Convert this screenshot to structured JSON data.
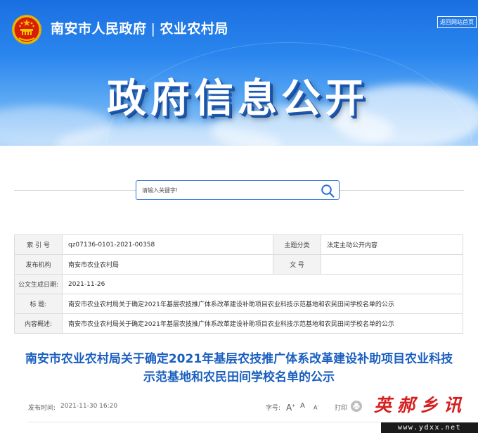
{
  "header": {
    "site_name_part1": "南安市人民政府",
    "separator": "|",
    "site_name_part2": "农业农村局",
    "home_link": "返回网站首页",
    "banner_title": "政府信息公开"
  },
  "search": {
    "placeholder": "请输入关键字!"
  },
  "meta": {
    "index_label": "索 引 号",
    "index_value": "qz07136-0101-2021-00358",
    "category_label": "主题分类",
    "category_value": "法定主动公开内容",
    "publisher_label": "发布机构",
    "publisher_value": "南安市农业农村局",
    "doc_no_label": "文 号",
    "doc_no_value": "",
    "date_label": "公文生成日期:",
    "date_value": "2021-11-26",
    "title_label": "标 题:",
    "title_value": "南安市农业农村局关于确定2021年基层农技推广体系改革建设补助项目农业科技示范基地和农民田间学校名单的公示",
    "summary_label": "内容概述:",
    "summary_value": "南安市农业农村局关于确定2021年基层农技推广体系改革建设补助项目农业科技示范基地和农民田间学校名单的公示"
  },
  "article": {
    "title": "南安市农业农村局关于确定2021年基层农技推广体系改革建设补助项目农业科技示范基地和农民田间学校名单的公示",
    "pub_label": "发布时间:",
    "pub_time": "2021-11-30 16:20",
    "font_label": "字号:",
    "font_large": "A",
    "font_medium": "A",
    "font_small": "A",
    "font_plus": "+",
    "font_minus": "-",
    "print_label": "打印"
  },
  "watermark": {
    "text": "英郝乡讯",
    "url": "www.ydxx.net"
  },
  "colors": {
    "banner_top": "#1a6fe0",
    "title_blue": "#1a5fbf",
    "search_border": "#2b6fd6",
    "watermark_red": "#d61f1f"
  },
  "icons": {
    "emblem": "national-emblem-icon",
    "search": "search-icon",
    "print": "print-icon"
  }
}
